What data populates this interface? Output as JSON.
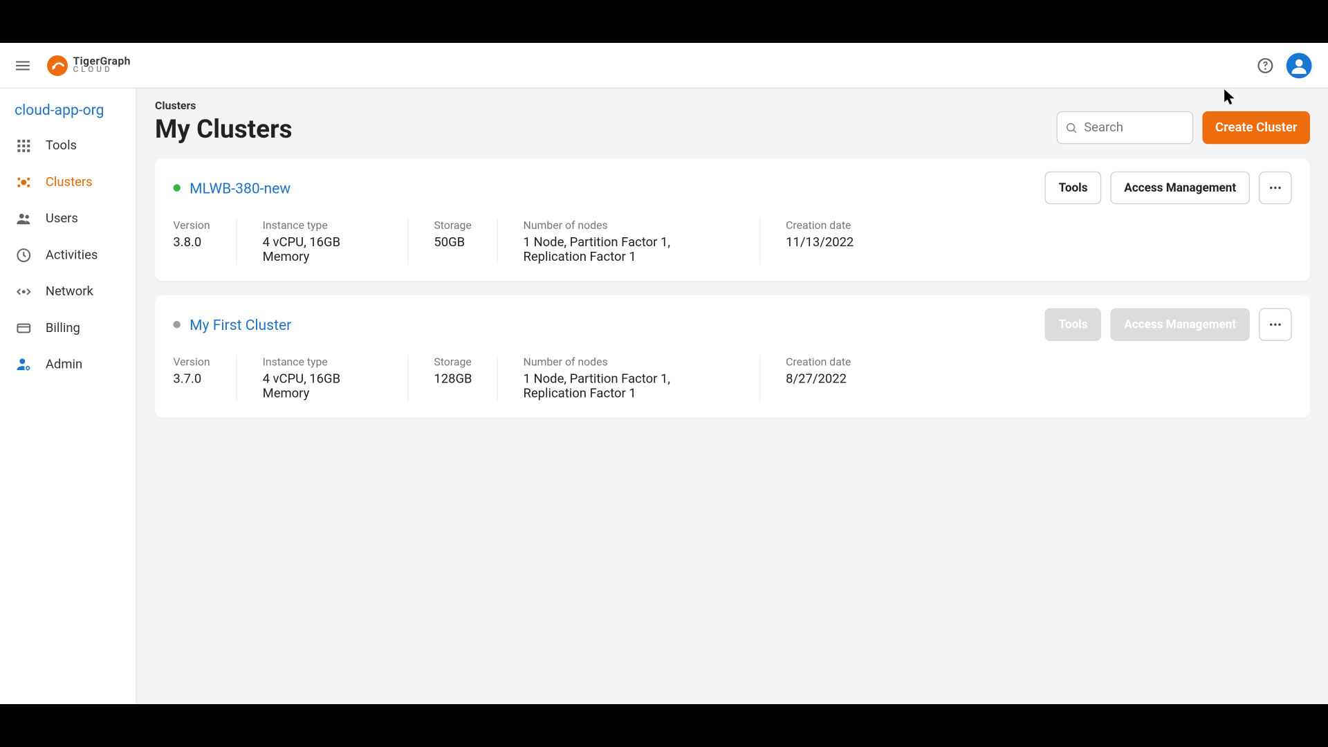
{
  "brand": {
    "line1": "TigerGraph",
    "line2": "CLOUD"
  },
  "header": {
    "help_aria": "Help"
  },
  "sidebar": {
    "org": "cloud-app-org",
    "items": [
      {
        "key": "tools",
        "label": "Tools"
      },
      {
        "key": "clusters",
        "label": "Clusters"
      },
      {
        "key": "users",
        "label": "Users"
      },
      {
        "key": "activities",
        "label": "Activities"
      },
      {
        "key": "network",
        "label": "Network"
      },
      {
        "key": "billing",
        "label": "Billing"
      },
      {
        "key": "admin",
        "label": "Admin"
      }
    ]
  },
  "page": {
    "breadcrumb": "Clusters",
    "title": "My Clusters",
    "search_placeholder": "Search",
    "create_label": "Create Cluster"
  },
  "labels": {
    "version": "Version",
    "instance_type": "Instance type",
    "storage": "Storage",
    "nodes": "Number of nodes",
    "creation_date": "Creation date",
    "tools": "Tools",
    "access_mgmt": "Access Management"
  },
  "clusters": [
    {
      "name": "MLWB-380-new",
      "status": "running",
      "version": "3.8.0",
      "instance_type": "4 vCPU, 16GB Memory",
      "storage": "50GB",
      "nodes": "1 Node, Partition Factor 1, Replication Factor 1",
      "creation_date": "11/13/2022",
      "actions_enabled": true
    },
    {
      "name": "My First Cluster",
      "status": "stopped",
      "version": "3.7.0",
      "instance_type": "4 vCPU, 16GB Memory",
      "storage": "128GB",
      "nodes": "1 Node, Partition Factor 1, Replication Factor 1",
      "creation_date": "8/27/2022",
      "actions_enabled": false
    }
  ]
}
